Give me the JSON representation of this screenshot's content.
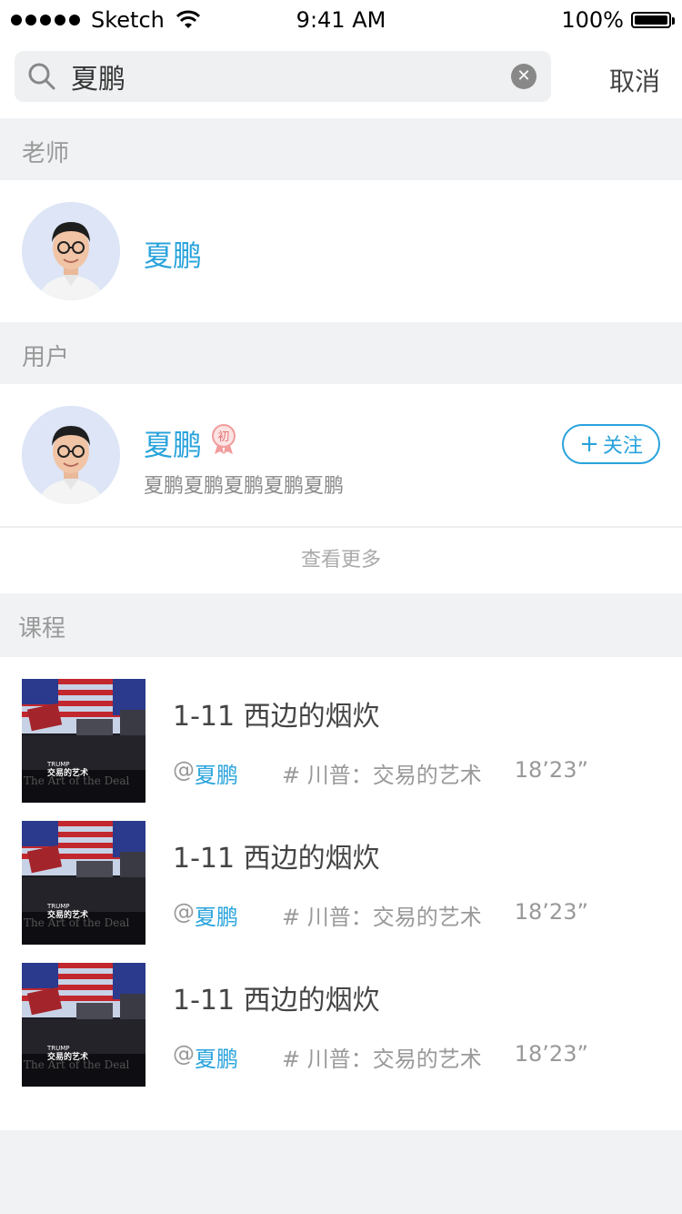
{
  "status_bar": {
    "carrier": "Sketch",
    "time": "9:41 AM",
    "battery": "100%"
  },
  "search": {
    "query": "夏鹏",
    "cancel_label": "取消"
  },
  "sections": {
    "teacher_title": "老师",
    "user_title": "用户",
    "course_title": "课程"
  },
  "teacher": {
    "name": "夏鹏"
  },
  "user": {
    "name": "夏鹏",
    "badge": "初",
    "description": "夏鹏夏鹏夏鹏夏鹏夏鹏",
    "follow_label": "关注"
  },
  "see_more_label": "查看更多",
  "courses": [
    {
      "title": "1-11 西边的烟炊",
      "at": "@",
      "author": "夏鹏",
      "series": "# 川普：交易的艺术",
      "duration": "18’23”"
    },
    {
      "title": "1-11 西边的烟炊",
      "at": "@",
      "author": "夏鹏",
      "series": "# 川普：交易的艺术",
      "duration": "18’23”"
    },
    {
      "title": "1-11 西边的烟炊",
      "at": "@",
      "author": "夏鹏",
      "series": "# 川普：交易的艺术",
      "duration": "18’23”"
    }
  ],
  "thumbnail_text": {
    "line1": "TRUMP",
    "line2": "交易的艺术",
    "line3": "The Art of the Deal"
  },
  "colors": {
    "accent": "#29a3dc",
    "background": "#f0f2f4",
    "panel": "#ffffff"
  }
}
